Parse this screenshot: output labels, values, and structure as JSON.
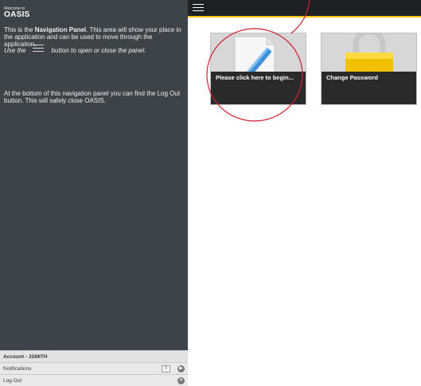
{
  "sidebar": {
    "welcome": "Welcome to",
    "app_name": "OASIS",
    "para1_prefix": "This is the ",
    "para1_bold": "Navigation Panel",
    "para1_suffix": ". This area will show your place in the application and can be used to move through the application.",
    "para2_prefix": "Use the",
    "para2_suffix": "button to open or close the panel.",
    "para3": "At the bottom of this navigation panel you can find the Log Out button. This will safely close OASIS.",
    "footer": {
      "account": "Account - JSMITH",
      "notifications": "Notifications",
      "notifications_count": "0",
      "logout": "Log Out"
    }
  },
  "tiles": [
    {
      "label": "Please click here to begin..."
    },
    {
      "label": "Change Password"
    }
  ],
  "colors": {
    "sidebar_bg": "#3c4349",
    "topbar_bg": "#1d2126",
    "accent": "#ffc400",
    "annotation": "#d0202a"
  },
  "icons": {
    "menu": "hamburger-icon",
    "begin_tile": "pencil-document-icon",
    "password_tile": "padlock-icon",
    "notifications": "arrow-right-icon",
    "logout": "close-icon"
  }
}
